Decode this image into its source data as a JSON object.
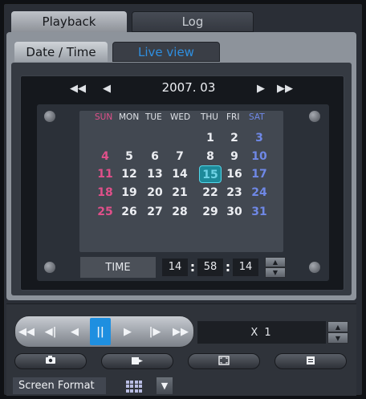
{
  "tabs": {
    "playback": "Playback",
    "log": "Log"
  },
  "subtabs": {
    "date_time": "Date / Time",
    "live_view": "Live view"
  },
  "calendar": {
    "year_month": "2007. 03",
    "nav": {
      "prev_year": "◀◀",
      "prev_month": "◀",
      "next_month": "▶",
      "next_year": "▶▶"
    },
    "weekdays": [
      "SUN",
      "MON",
      "TUE",
      "WED",
      "THU",
      "FRI",
      "SAT"
    ],
    "weeks": [
      [
        "",
        "",
        "",
        "",
        "1",
        "2",
        "3"
      ],
      [
        "4",
        "5",
        "6",
        "7",
        "8",
        "9",
        "10"
      ],
      [
        "11",
        "12",
        "13",
        "14",
        "15",
        "16",
        "17"
      ],
      [
        "18",
        "19",
        "20",
        "21",
        "22",
        "23",
        "24"
      ],
      [
        "25",
        "26",
        "27",
        "28",
        "29",
        "30",
        "31"
      ]
    ],
    "selected_day": "15"
  },
  "time": {
    "label": "TIME",
    "hour": "14",
    "minute": "58",
    "second": "14",
    "sep": ":"
  },
  "playback_controls": {
    "buttons": [
      "◀◀",
      "◀|",
      "◀",
      "||",
      "▶",
      "|▶",
      "▶▶"
    ],
    "active_index": 3
  },
  "speed": "X 1",
  "toolbar": {
    "snapshot_icon": "camera-icon",
    "export_icon": "export-icon",
    "fullscreen_icon": "fullscreen-icon",
    "list_icon": "list-icon"
  },
  "screen_format": {
    "label": "Screen Format",
    "dropdown": "▼"
  },
  "colors": {
    "accent_blue": "#1e8fe0",
    "sunday": "#e0508a",
    "saturday": "#6f88e6",
    "today": "#52d6e8"
  }
}
